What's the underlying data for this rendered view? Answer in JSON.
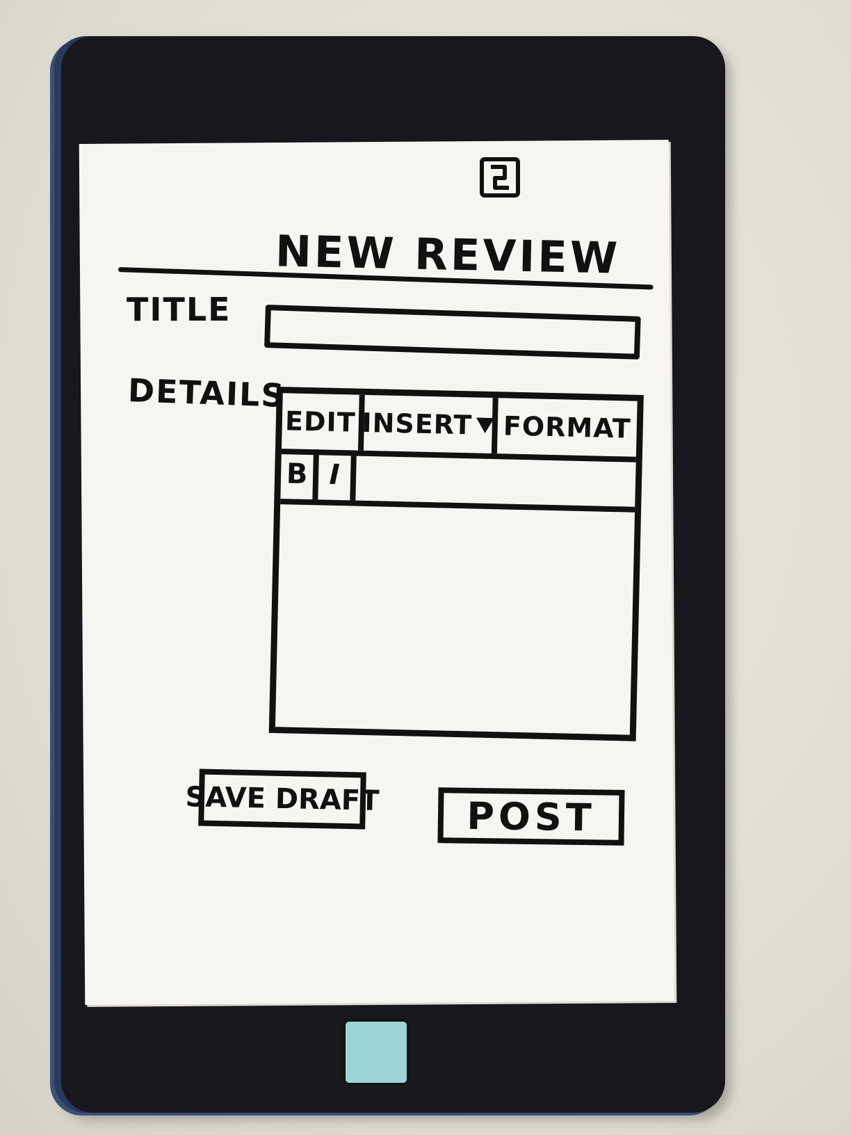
{
  "app": {
    "header_title": "NEW REVIEW"
  },
  "form": {
    "title_label": "TITLE",
    "title_value": "",
    "details_label": "DETAILS",
    "details_value": ""
  },
  "editor": {
    "menu": {
      "edit_label": "EDIT",
      "insert_label": "INSERT",
      "format_label": "FORMAT"
    },
    "toolbar": {
      "bold_label": "B",
      "italic_label": "I"
    }
  },
  "actions": {
    "save_draft_label": "SAVE DRAFT",
    "post_label": "POST"
  },
  "icons": {
    "corner": "window-switch-icon",
    "home": "home-button-icon",
    "insert_dropdown": "caret-down-icon"
  },
  "colors": {
    "ink": "#111111",
    "paper": "#f6f5f1",
    "device": "#17171c",
    "home_button": "#9dd4d6"
  }
}
